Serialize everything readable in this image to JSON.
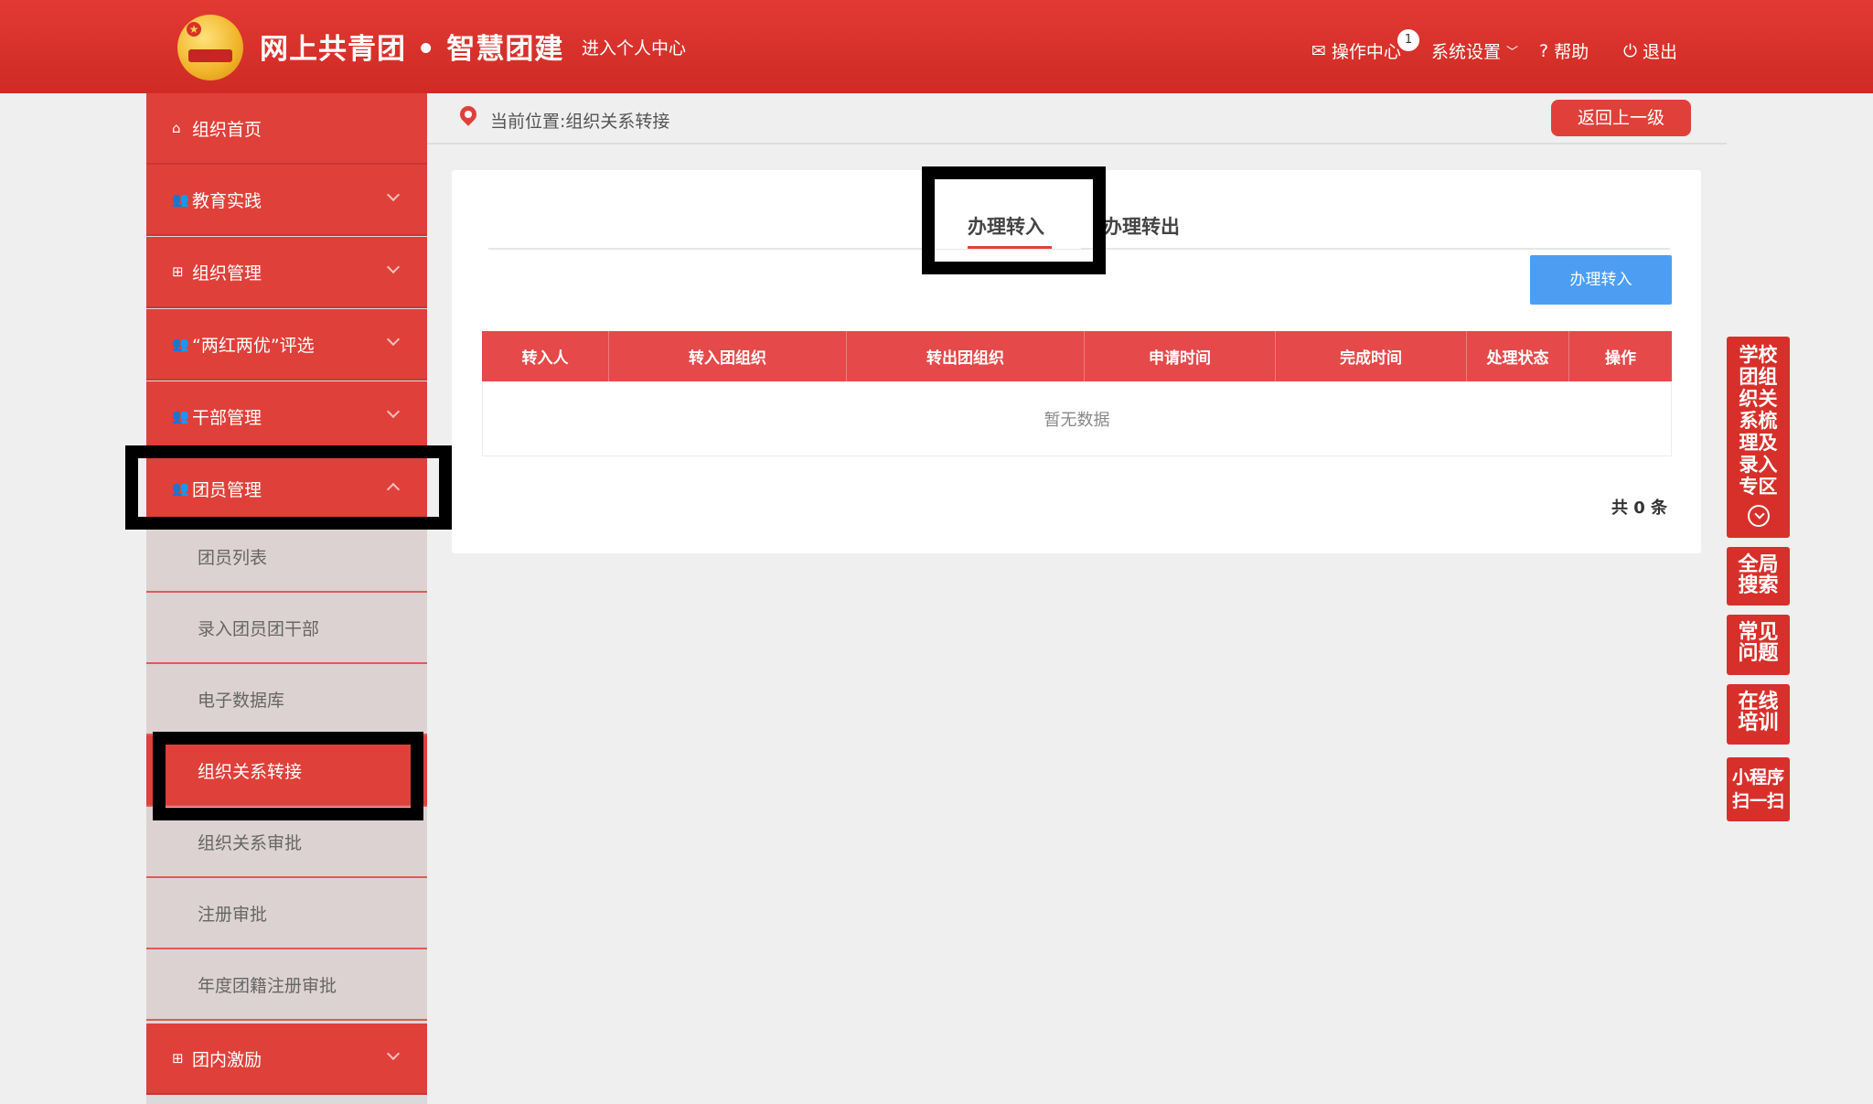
{
  "header": {
    "title": "网上共青团 • 智慧团建",
    "personal_center": "进入个人中心",
    "ops_center": "操作中心",
    "ops_badge": "1",
    "settings": "系统设置",
    "help": "帮助",
    "logout": "退出"
  },
  "sidebar": {
    "items": [
      {
        "label": "组织首页",
        "icon": "home-icon"
      },
      {
        "label": "教育实践",
        "icon": "users-icon"
      },
      {
        "label": "组织管理",
        "icon": "sitemap-icon"
      },
      {
        "label": "“两红两优”评选",
        "icon": "users-icon"
      },
      {
        "label": "干部管理",
        "icon": "users-icon"
      },
      {
        "label": "团员管理",
        "icon": "users-icon"
      },
      {
        "label": "团内激励",
        "icon": "sitemap-icon"
      }
    ],
    "sub_items": [
      {
        "label": "团员列表"
      },
      {
        "label": "录入团员团干部"
      },
      {
        "label": "电子数据库"
      },
      {
        "label": "组织关系转接"
      },
      {
        "label": "组织关系审批"
      },
      {
        "label": "注册审批"
      },
      {
        "label": "年度团籍注册审批"
      }
    ]
  },
  "breadcrumb": {
    "text": "当前位置:组织关系转接",
    "back": "返回上一级"
  },
  "main": {
    "tabs": [
      {
        "label": "办理转入"
      },
      {
        "label": "办理转出"
      }
    ],
    "action_button": "办理转入",
    "table": {
      "headers": [
        "转入人",
        "转入团组织",
        "转出团组织",
        "申请时间",
        "完成时间",
        "处理状态",
        "操作"
      ],
      "empty_text": "暂无数据"
    },
    "total": "共 0 条"
  },
  "right_tabs": [
    {
      "label": "学校团组织关系梳理及录入专区"
    },
    {
      "label": "全局搜索"
    },
    {
      "label": "常见问题"
    },
    {
      "label": "在线培训"
    },
    {
      "label": "小程序扫一扫"
    }
  ],
  "colors": {
    "brand_red": "#e0403a",
    "header_red": "#d7302b",
    "blue_button": "#4d9ef2"
  }
}
